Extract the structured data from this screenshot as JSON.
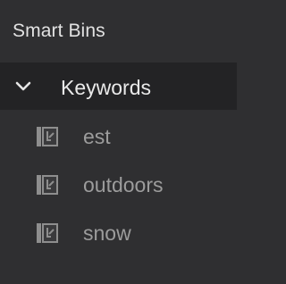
{
  "panel": {
    "title": "Smart Bins",
    "group": {
      "label": "Keywords",
      "expanded": true,
      "icon": "chevron-down-icon"
    },
    "items": [
      {
        "label": "est",
        "icon": "keyword-bin-icon"
      },
      {
        "label": "outdoors",
        "icon": "keyword-bin-icon"
      },
      {
        "label": "snow",
        "icon": "keyword-bin-icon"
      }
    ]
  },
  "colors": {
    "background": "#2f2f31",
    "selected_row": "#232325",
    "title_text": "#e2e2e2",
    "item_text": "#9c9c9c"
  }
}
